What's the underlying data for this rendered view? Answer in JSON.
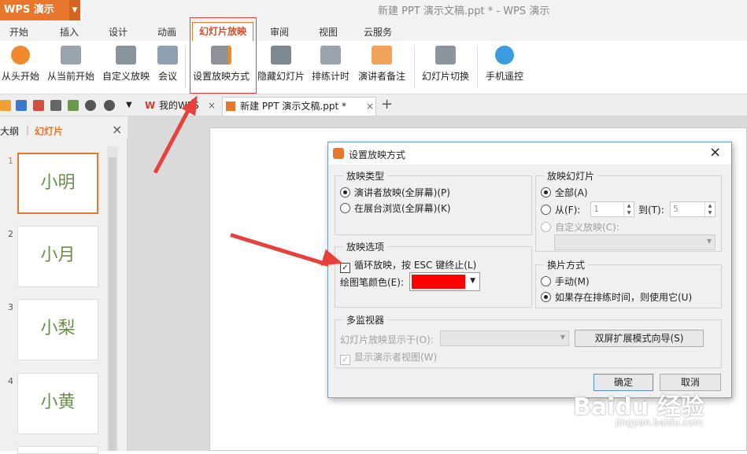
{
  "app": {
    "name": "WPS 演示",
    "window_title": "新建 PPT 演示文稿.ppt * - WPS 演示"
  },
  "menu": {
    "tabs": [
      "开始",
      "插入",
      "设计",
      "动画",
      "幻灯片放映",
      "审阅",
      "视图",
      "云服务"
    ],
    "active": "幻灯片放映"
  },
  "ribbon": {
    "buttons": [
      "从头开始",
      "从当前开始",
      "自定义放映",
      "会议",
      "设置放映方式",
      "隐藏幻灯片",
      "排练计时",
      "演讲者备注",
      "幻灯片切换",
      "手机遥控"
    ]
  },
  "doc_tabs": {
    "tab1": "我的WPS",
    "tab2": "新建 PPT 演示文稿.ppt *",
    "add": "+"
  },
  "left_panel": {
    "tab_outline": "大纲",
    "tab_slides": "幻灯片",
    "slides": [
      {
        "num": "1",
        "text": "小明"
      },
      {
        "num": "2",
        "text": "小月"
      },
      {
        "num": "3",
        "text": "小梨"
      },
      {
        "num": "4",
        "text": "小黄"
      }
    ]
  },
  "dialog": {
    "title": "设置放映方式",
    "type_group": {
      "label": "放映类型",
      "opt1": "演讲者放映(全屏幕)(P)",
      "opt2": "在展台浏览(全屏幕)(K)"
    },
    "slides_group": {
      "label": "放映幻灯片",
      "all": "全部(A)",
      "from": "从(F):",
      "from_value": "1",
      "to": "到(T):",
      "to_value": "5",
      "custom": "自定义放映(C):"
    },
    "options_group": {
      "label": "放映选项",
      "loop": "循环放映，按 ESC 键终止(L)",
      "pen_color": "绘图笔颜色(E):",
      "pen_color_value": "#ff0000"
    },
    "advance_group": {
      "label": "换片方式",
      "manual": "手动(M)",
      "timing": "如果存在排练时间，则使用它(U)"
    },
    "monitor_group": {
      "label": "多监视器",
      "show_on": "幻灯片放映显示于(O):",
      "dual_button": "双屏扩展模式向导(S)",
      "presenter_view": "显示演示者视图(W)"
    },
    "ok": "确定",
    "cancel": "取消"
  },
  "watermark": {
    "brand": "Baidu 经验",
    "url": "jingyan.baidu.com"
  }
}
